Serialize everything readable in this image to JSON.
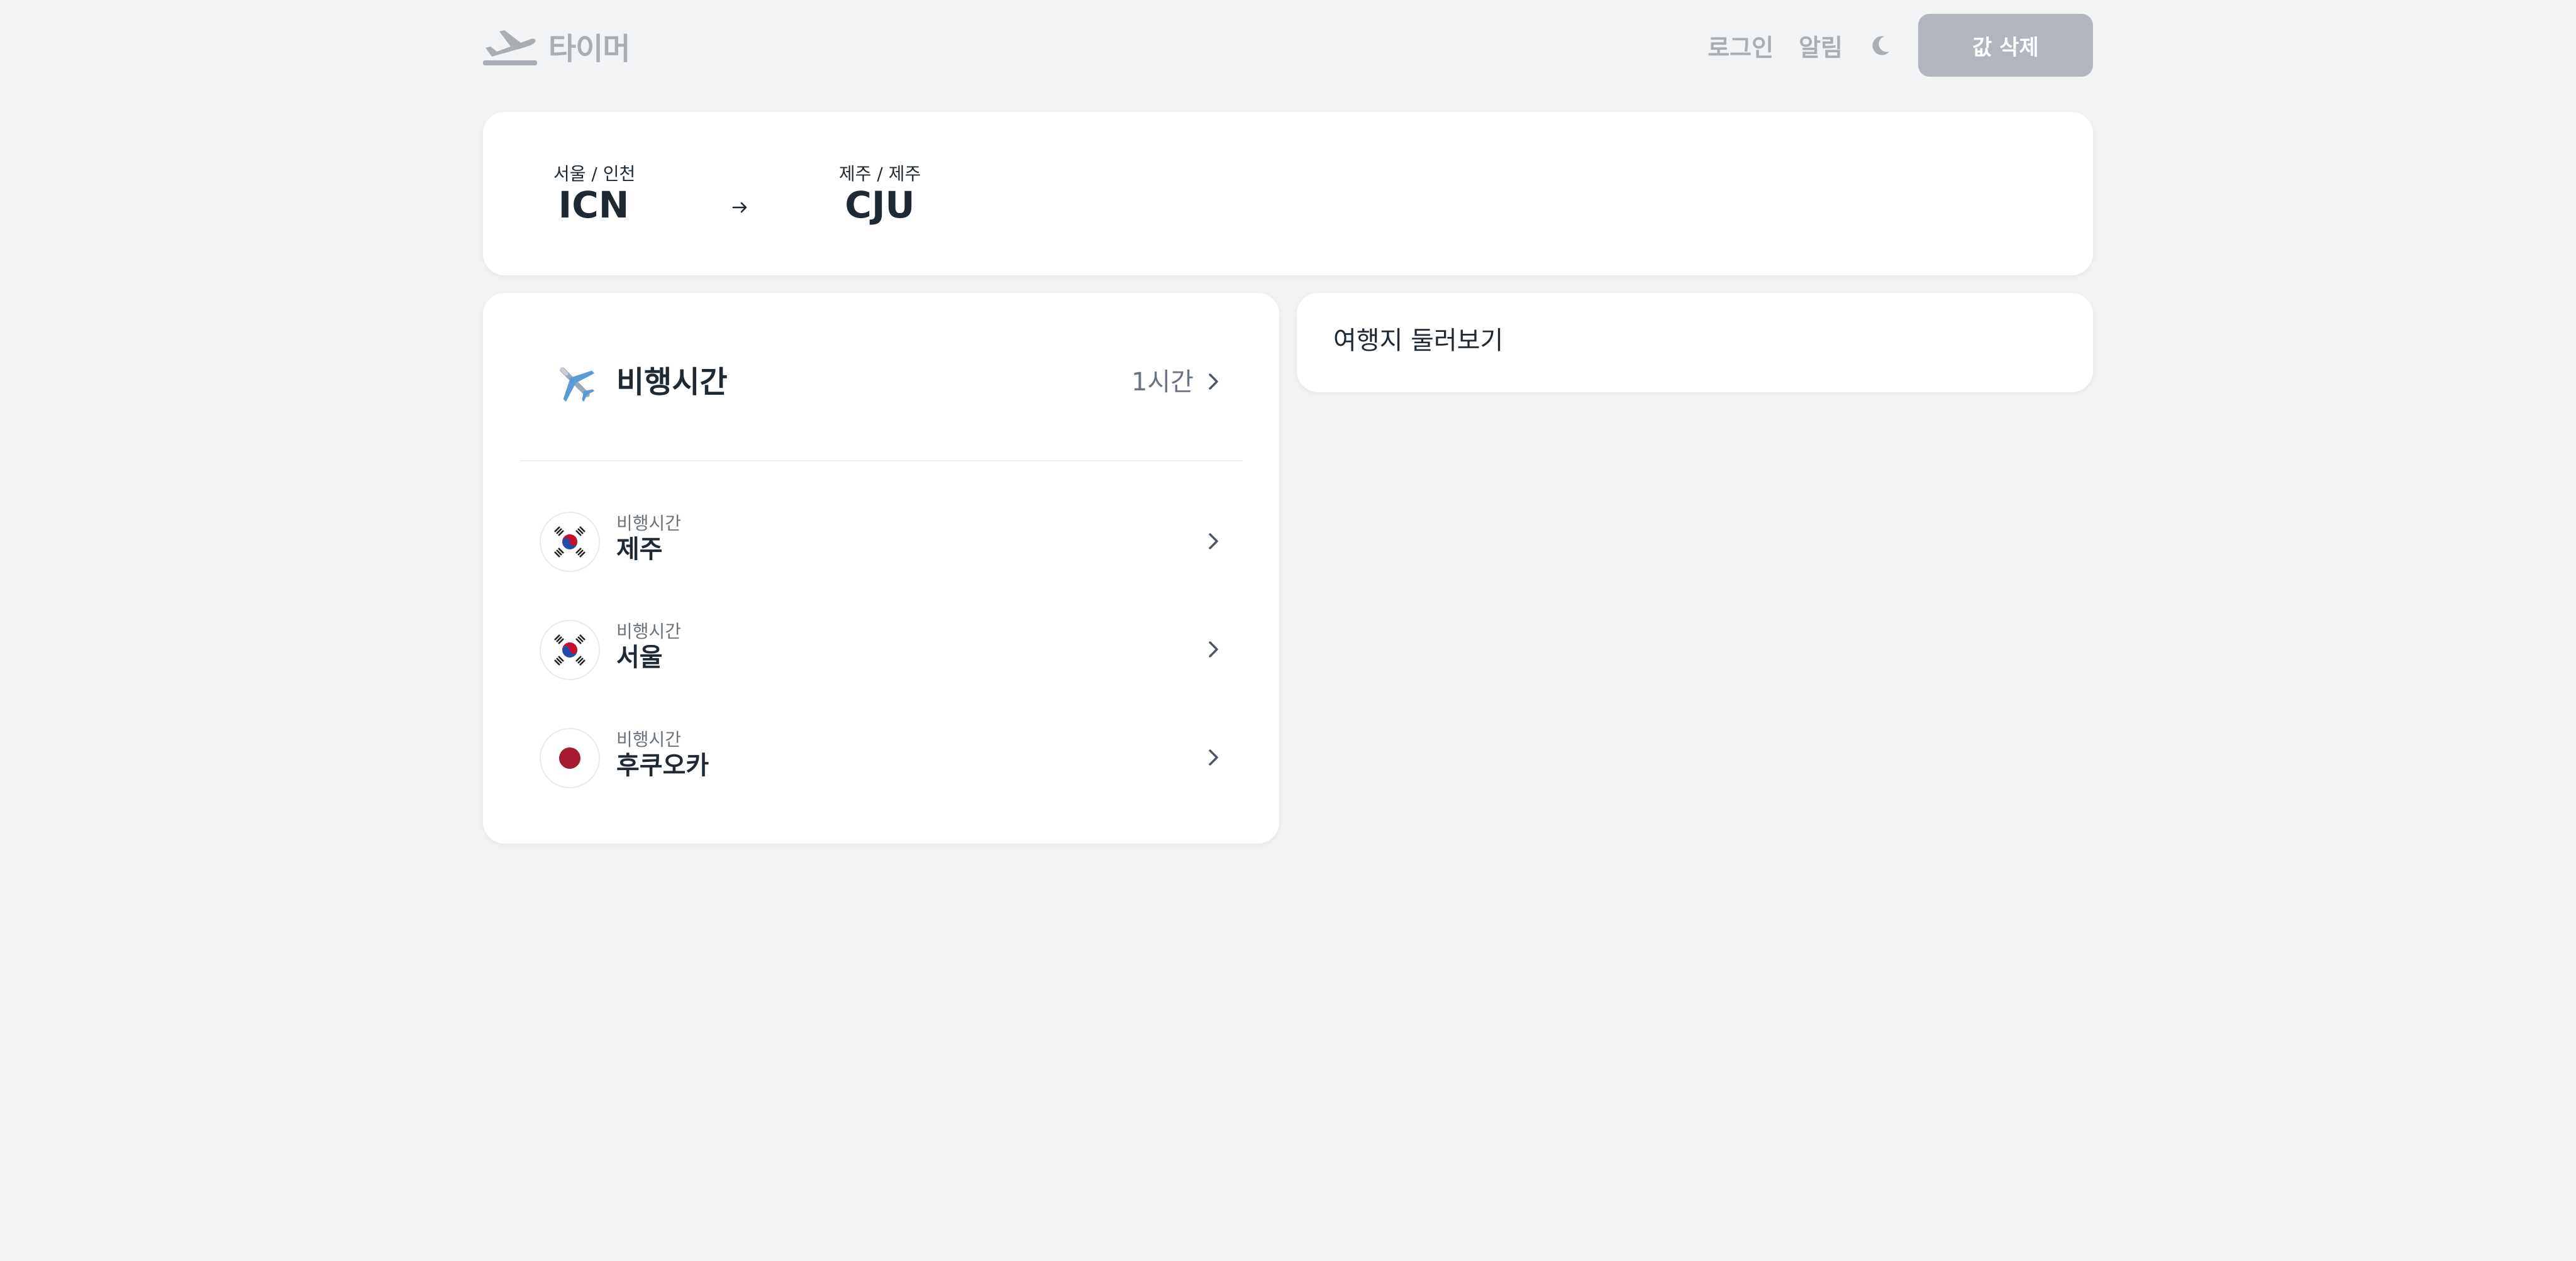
{
  "header": {
    "app_name": "타이머",
    "login_label": "로그인",
    "notifications_label": "알림",
    "clear_button_label": "값 삭제"
  },
  "route": {
    "origin": {
      "city": "서울 / 인천",
      "code": "ICN"
    },
    "destination": {
      "city": "제주 / 제주",
      "code": "CJU"
    }
  },
  "flight_time": {
    "title": "비행시간",
    "value": "1시간",
    "items": [
      {
        "subtitle": "비행시간",
        "name": "제주",
        "flag": "south-korea-flag"
      },
      {
        "subtitle": "비행시간",
        "name": "서울",
        "flag": "south-korea-flag"
      },
      {
        "subtitle": "비행시간",
        "name": "후쿠오카",
        "flag": "japan-flag"
      }
    ]
  },
  "explore": {
    "title": "여행지 둘러보기"
  },
  "colors": {
    "background": "#f2f3f5",
    "card": "#ffffff",
    "muted": "#a9aeb5",
    "button": "#b1b6be",
    "text": "#1f2933"
  },
  "icons": {
    "logo": "plane-takeoff-icon",
    "theme_toggle": "moon-icon",
    "route_arrow": "arrow-right-icon",
    "flight_time": "airplane-icon",
    "chevron": "chevron-right-icon"
  }
}
